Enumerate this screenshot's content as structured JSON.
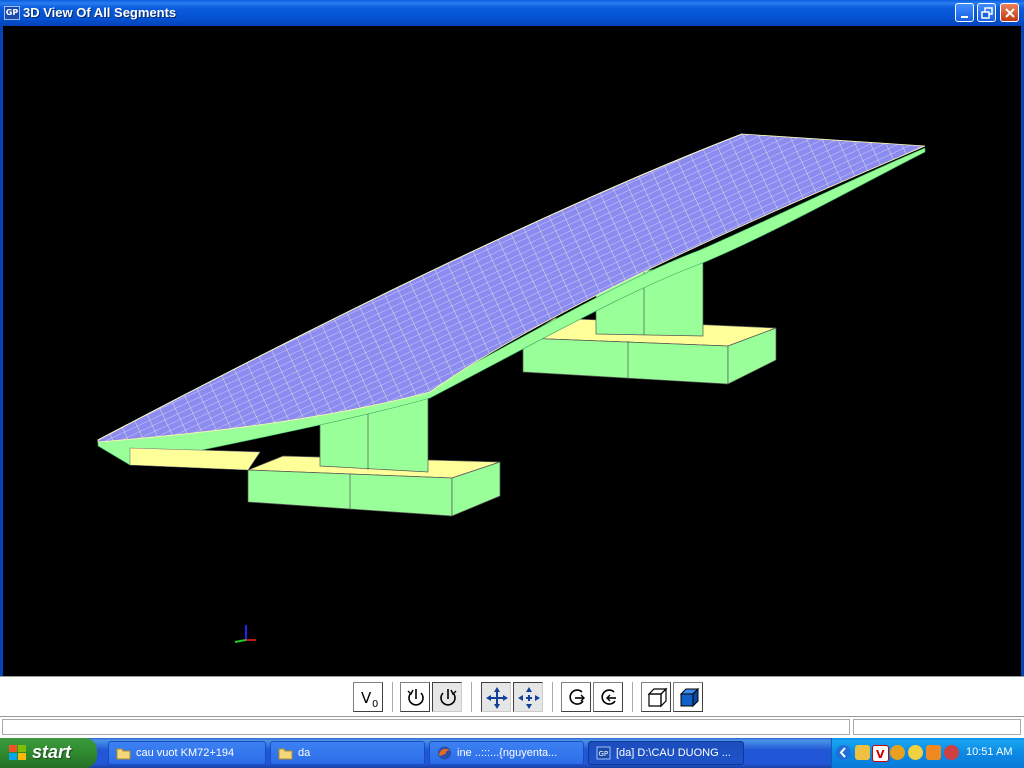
{
  "window": {
    "title": "3D View Of All Segments",
    "app_icon_text": "GP",
    "controls": [
      "minimize",
      "maximize",
      "close"
    ]
  },
  "toolbar": {
    "buttons": [
      {
        "name": "view-origin",
        "label": "V0"
      },
      {
        "name": "rotate-left",
        "icon": "rotate-ccw-icon"
      },
      {
        "name": "rotate-right",
        "icon": "rotate-cw-icon"
      },
      {
        "name": "pan",
        "icon": "move-arrows-icon"
      },
      {
        "name": "pan-alt",
        "icon": "move-arrows-icon"
      },
      {
        "name": "zoom-in",
        "icon": "zoom-rotate-icon"
      },
      {
        "name": "zoom-out",
        "icon": "zoom-rotate-icon"
      },
      {
        "name": "wireframe",
        "icon": "wireframe-cube-icon"
      },
      {
        "name": "solid",
        "icon": "solid-cube-icon"
      }
    ]
  },
  "viewport": {
    "background": "#000000",
    "deck_color": "#8080ff",
    "pier_color": "#99ff99",
    "footing_top_color": "#ffff99"
  },
  "taskbar": {
    "start_label": "start",
    "tasks": [
      {
        "label": "cau vuot KM72+194",
        "icon": "folder-icon"
      },
      {
        "label": "da",
        "icon": "folder-icon"
      },
      {
        "label": "ine ..:::...{nguyenta...",
        "icon": "firefox-icon"
      },
      {
        "label": "[da]  D:\\CAU DUONG ...",
        "icon": "app-gp-icon",
        "active": true
      }
    ],
    "clock": "10:51 AM"
  }
}
